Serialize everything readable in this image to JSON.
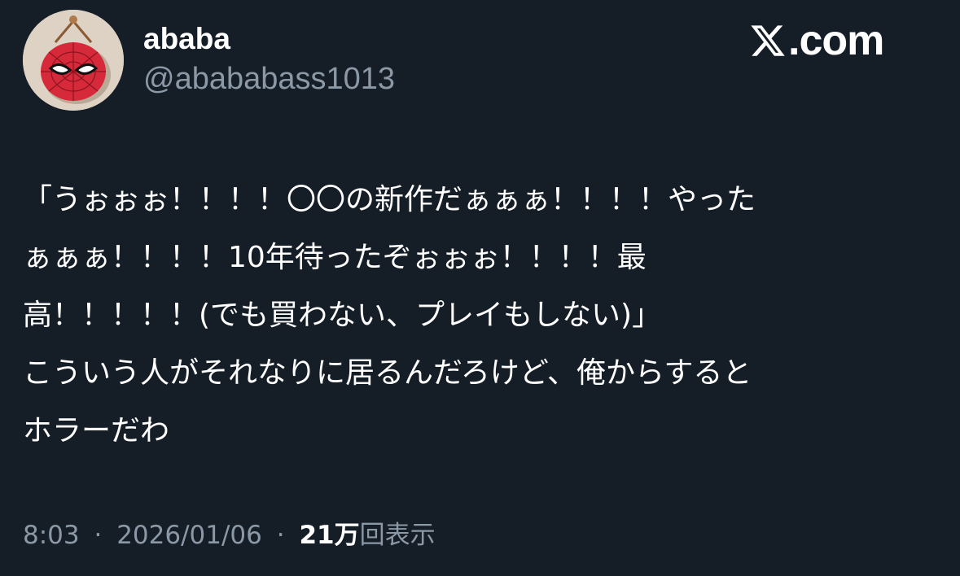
{
  "author": {
    "display_name": "ababa",
    "handle": "@abababass1013",
    "avatar_icon": "spiderman-mask-icon"
  },
  "brand": {
    "label": ".com",
    "icon": "x-logo-icon"
  },
  "tweet": {
    "lines": [
      "「うぉぉぉ！！！！〇〇の新作だぁぁぁ！！！！やった",
      "ぁぁぁ！！！！10年待ったぞぉぉぉ！！！！最",
      "高！！！！！(でも買わない、プレイもしない)」",
      "こういう人がそれなりに居るんだろけど、俺からすると",
      "ホラーだわ"
    ]
  },
  "meta": {
    "time": "8:03",
    "separator": "·",
    "date": "2026/01/06",
    "views_count": "21万",
    "views_label": "回表示"
  },
  "colors": {
    "background": "#151d27",
    "primary_text": "#ffffff",
    "secondary_text": "#8b98a5"
  }
}
